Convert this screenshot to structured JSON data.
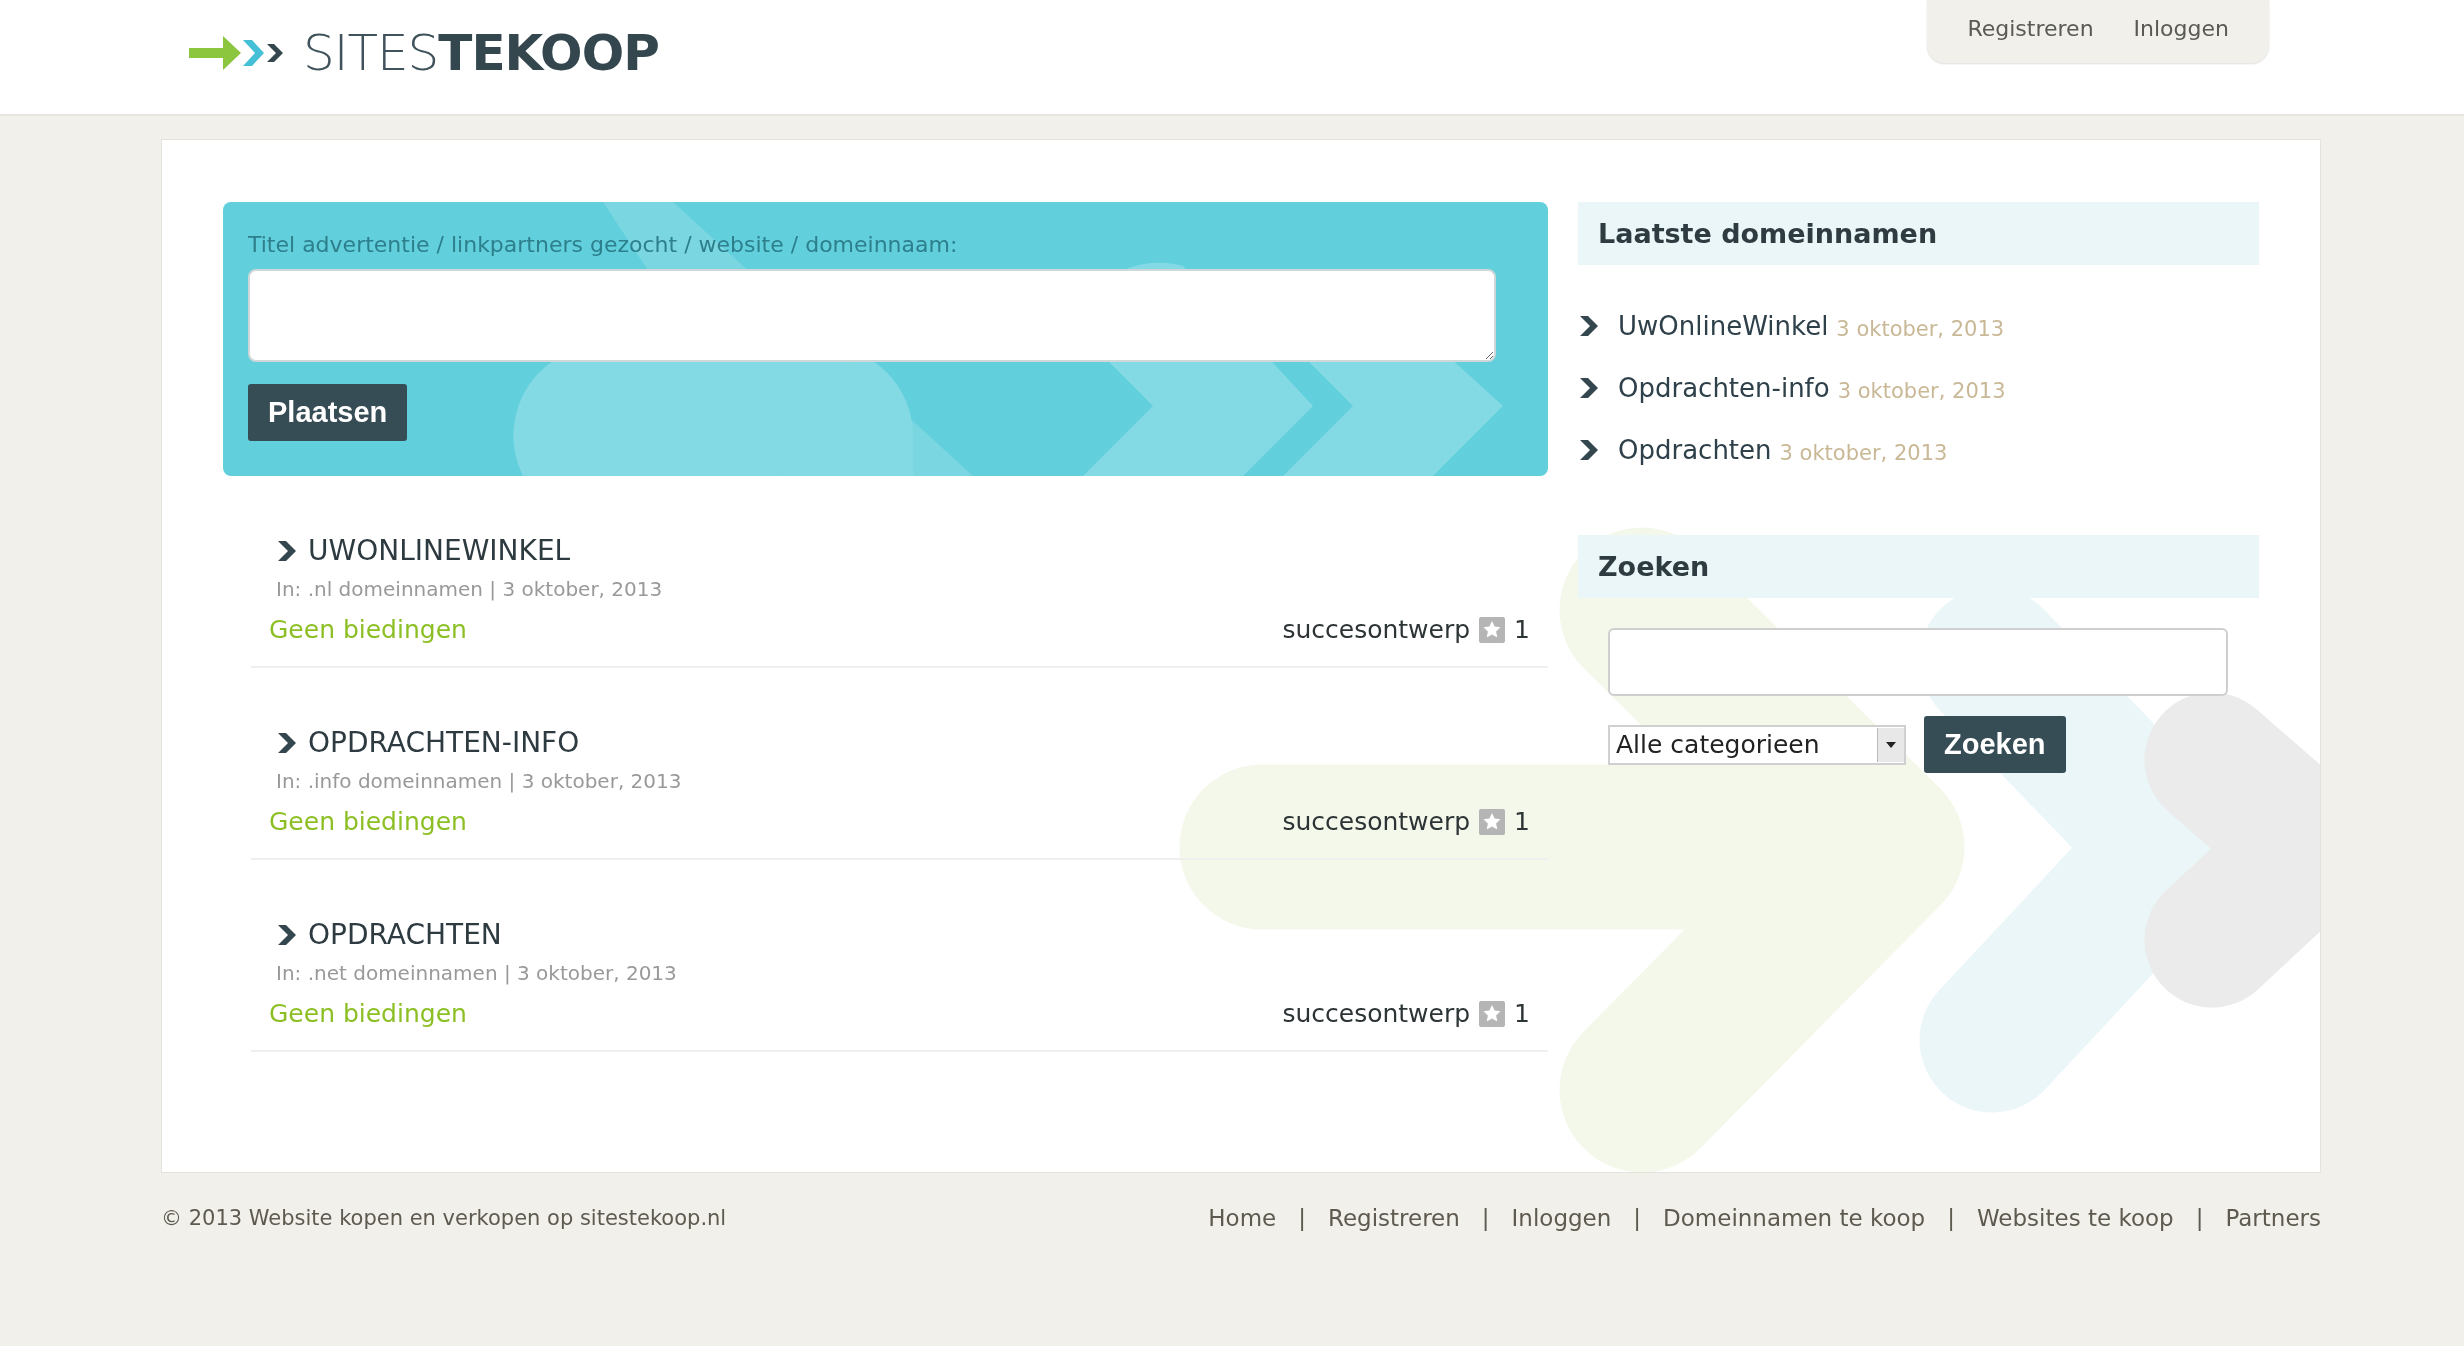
{
  "header": {
    "logo": "SITES**TEKOOP**",
    "nav": [
      "Registreren",
      "Inloggen"
    ]
  },
  "post_form": {
    "label": "Titel advertentie / linkpartners gezocht / website / domeinnaam:",
    "button": "Plaatsen"
  },
  "listings": [
    {
      "title": "UWONLINEWINKEL",
      "meta": "In: .nl domeinnamen | 3 oktober, 2013",
      "bids": "Geen biedingen",
      "user": "succesontwerp",
      "count": "1"
    },
    {
      "title": "OPDRACHTEN-INFO",
      "meta": "In: .info domeinnamen | 3 oktober, 2013",
      "bids": "Geen biedingen",
      "user": "succesontwerp",
      "count": "1"
    },
    {
      "title": "OPDRACHTEN",
      "meta": "In: .net domeinnamen | 3 oktober, 2013",
      "bids": "Geen biedingen",
      "user": "succesontwerp",
      "count": "1"
    }
  ],
  "sidebar": {
    "latest": {
      "title": "Laatste domeinnamen",
      "items": [
        {
          "name": "UwOnlineWinkel",
          "date": "3 oktober, 2013"
        },
        {
          "name": "Opdrachten-info",
          "date": "3 oktober, 2013"
        },
        {
          "name": "Opdrachten",
          "date": "3 oktober, 2013"
        }
      ]
    },
    "search": {
      "title": "Zoeken",
      "category": "Alle categorieen",
      "button": "Zoeken"
    }
  },
  "footer": {
    "copyright": "© 2013 Website kopen en verkopen op sitestekoop.nl",
    "links": [
      "Home",
      "Registreren",
      "Inloggen",
      "Domeinnamen te koop",
      "Websites te koop",
      "Partners"
    ],
    "separator": "|"
  }
}
